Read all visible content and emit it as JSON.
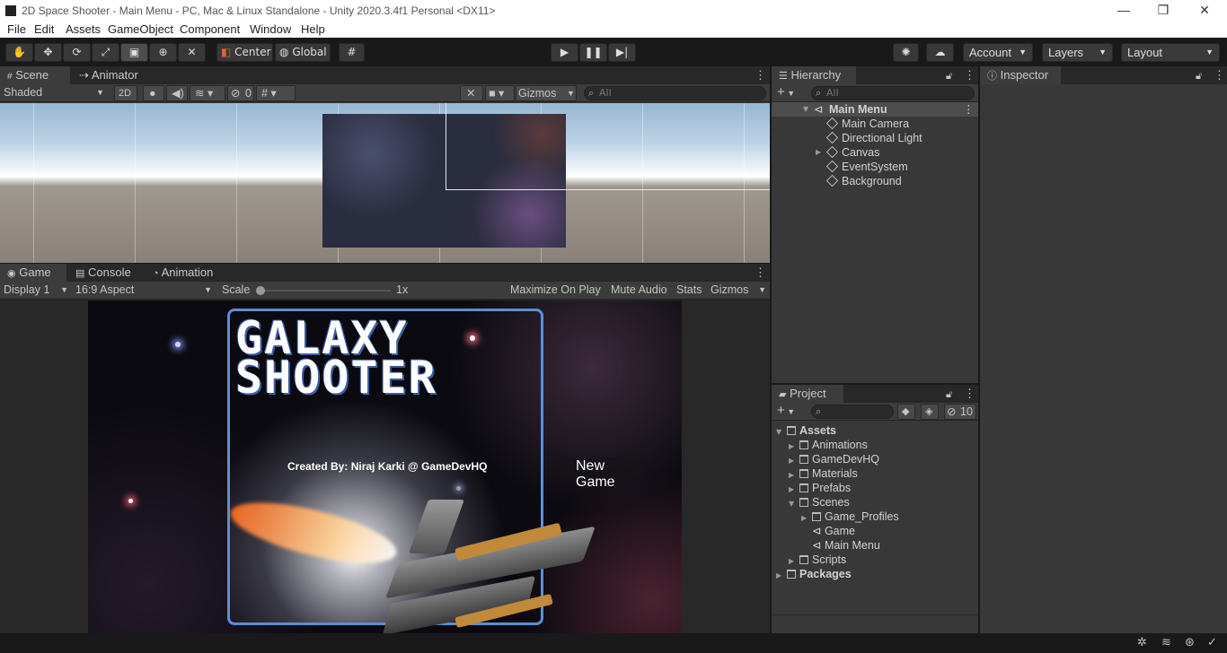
{
  "window": {
    "title": "2D Space Shooter - Main Menu - PC, Mac & Linux Standalone - Unity 2020.3.4f1 Personal <DX11>",
    "minimize": "—",
    "maximize": "❐",
    "close": "✕"
  },
  "menu": [
    "File",
    "Edit",
    "Assets",
    "GameObject",
    "Component",
    "Window",
    "Help"
  ],
  "toolbar": {
    "pivot_mode": "Center",
    "pivot_rotation": "Global",
    "account": "Account",
    "layers": "Layers",
    "layout": "Layout"
  },
  "scene": {
    "tabs": [
      "Scene",
      "Animator"
    ],
    "draw_mode": "Shaded",
    "mode_2d": "2D",
    "hidden_count": "0",
    "gizmos": "Gizmos",
    "search_placeholder": "All"
  },
  "game": {
    "tabs": [
      "Game",
      "Console",
      "Animation"
    ],
    "display": "Display 1",
    "aspect": "16:9 Aspect",
    "scale_label": "Scale",
    "scale_value": "1x",
    "scale_level": 0.0,
    "maximize_on_play": "Maximize On Play",
    "mute_audio": "Mute Audio",
    "stats": "Stats",
    "gizmos": "Gizmos"
  },
  "game_view": {
    "logo_line1": "GALAXY",
    "logo_line2": "SHOOTER",
    "credits": "Created By: Niraj Karki @ GameDevHQ",
    "new_game": "New Game"
  },
  "hierarchy": {
    "tab": "Hierarchy",
    "search_placeholder": "All",
    "scene": "Main Menu",
    "items": [
      "Main Camera",
      "Directional Light",
      "Canvas",
      "EventSystem",
      "Background"
    ]
  },
  "inspector": {
    "tab": "Inspector"
  },
  "project": {
    "tab": "Project",
    "hidden_count": "10",
    "root": "Assets",
    "folders": [
      "Animations",
      "GameDevHQ",
      "Materials",
      "Prefabs",
      "Scenes"
    ],
    "scenes_children": [
      "Game_Profiles",
      "Game",
      "Main Menu"
    ],
    "after_scenes": [
      "Scripts"
    ],
    "packages": "Packages"
  },
  "colors": {
    "editor_bg": "#383838",
    "toolbar_bg": "#191919",
    "tab_bg": "#282828",
    "selection": "#4d4d4d",
    "panel_frame": "#5a8fd6"
  }
}
